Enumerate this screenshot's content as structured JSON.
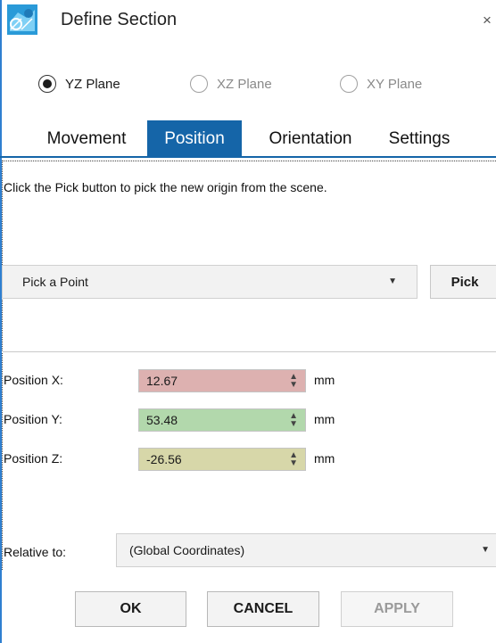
{
  "window": {
    "title": "Define Section",
    "close_symbol": "×",
    "icon": "section-app-icon"
  },
  "planes": [
    {
      "label": "YZ Plane",
      "checked": true,
      "enabled": true
    },
    {
      "label": "XZ Plane",
      "checked": false,
      "enabled": false
    },
    {
      "label": "XY Plane",
      "checked": false,
      "enabled": false
    }
  ],
  "tabs": [
    {
      "label": "Movement",
      "active": false
    },
    {
      "label": "Position",
      "active": true
    },
    {
      "label": "Orientation",
      "active": false
    },
    {
      "label": "Settings",
      "active": false
    }
  ],
  "position_tab": {
    "instruction": "Click the Pick button to pick the new origin from the scene.",
    "pick_mode": {
      "selected": "Pick a Point"
    },
    "pick_button": "Pick",
    "fields": [
      {
        "label": "Position X:",
        "value": "12.67",
        "unit": "mm",
        "color": "#ddb1b0"
      },
      {
        "label": "Position Y:",
        "value": "53.48",
        "unit": "mm",
        "color": "#b2d8ac"
      },
      {
        "label": "Position Z:",
        "value": "-26.56",
        "unit": "mm",
        "color": "#d7d7a9"
      }
    ],
    "relative_to": {
      "label": "Relative to:",
      "selected": "(Global Coordinates)"
    }
  },
  "buttons": {
    "ok": "OK",
    "cancel": "CANCEL",
    "apply": "APPLY"
  },
  "colors": {
    "accent": "#1565a8",
    "window_border": "#2f7fd0"
  }
}
